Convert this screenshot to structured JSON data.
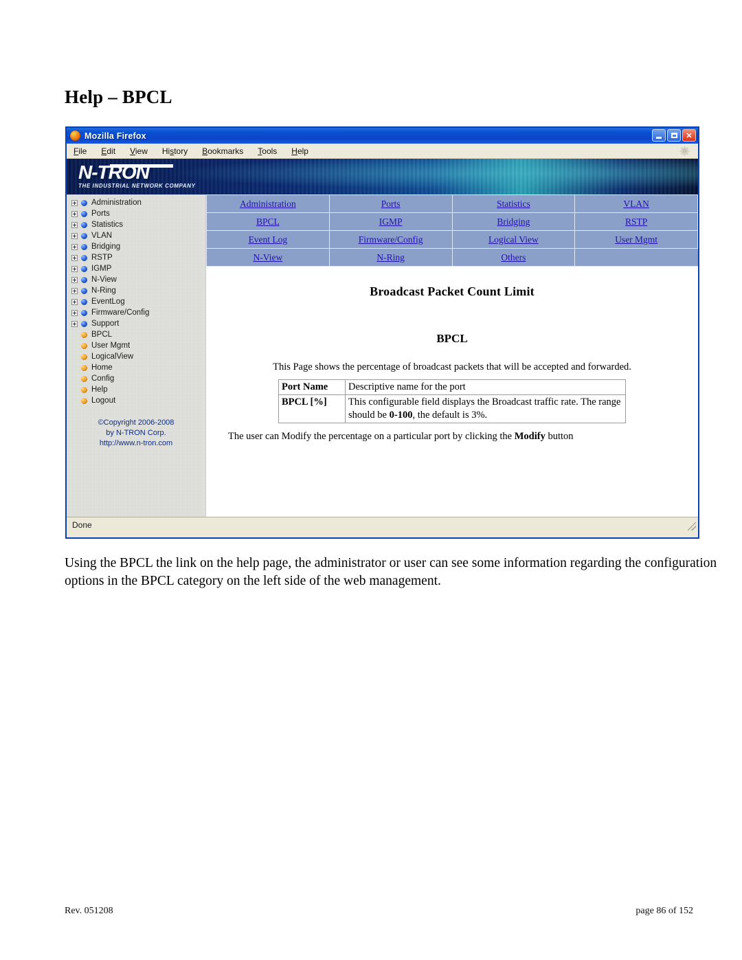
{
  "document": {
    "heading": "Help – BPCL",
    "paragraph": "Using the BPCL the link on the help page, the administrator or user can see some information regarding the configuration options in the BPCL category on the left side of the web management.",
    "footer_left": "Rev.  051208",
    "footer_right": "page 86 of 152"
  },
  "browser": {
    "title": "Mozilla Firefox",
    "app_icon": "firefox-icon",
    "window_buttons": {
      "minimize": "minimize-icon",
      "maximize": "maximize-icon",
      "close": "✕"
    },
    "menu": [
      {
        "label": "File",
        "accel": "F"
      },
      {
        "label": "Edit",
        "accel": "E"
      },
      {
        "label": "View",
        "accel": "V"
      },
      {
        "label": "History",
        "accel": "s"
      },
      {
        "label": "Bookmarks",
        "accel": "B"
      },
      {
        "label": "Tools",
        "accel": "T"
      },
      {
        "label": "Help",
        "accel": "H"
      }
    ],
    "toolbar_icon": "gear-icon",
    "status": "Done"
  },
  "banner": {
    "logo_text": "N-TRON",
    "logo_tagline": "THE INDUSTRIAL NETWORK COMPANY"
  },
  "sidebar": {
    "items": [
      {
        "label": "Administration",
        "expandable": true,
        "bullet": "blue"
      },
      {
        "label": "Ports",
        "expandable": true,
        "bullet": "blue"
      },
      {
        "label": "Statistics",
        "expandable": true,
        "bullet": "blue"
      },
      {
        "label": "VLAN",
        "expandable": true,
        "bullet": "blue"
      },
      {
        "label": "Bridging",
        "expandable": true,
        "bullet": "blue"
      },
      {
        "label": "RSTP",
        "expandable": true,
        "bullet": "blue"
      },
      {
        "label": "IGMP",
        "expandable": true,
        "bullet": "blue"
      },
      {
        "label": "N-View",
        "expandable": true,
        "bullet": "blue"
      },
      {
        "label": "N-Ring",
        "expandable": true,
        "bullet": "blue"
      },
      {
        "label": "EventLog",
        "expandable": true,
        "bullet": "blue"
      },
      {
        "label": "Firmware/Config",
        "expandable": true,
        "bullet": "blue"
      },
      {
        "label": "Support",
        "expandable": true,
        "bullet": "blue"
      },
      {
        "label": "BPCL",
        "expandable": false,
        "bullet": "orange"
      },
      {
        "label": "User Mgmt",
        "expandable": false,
        "bullet": "orange"
      },
      {
        "label": "LogicalView",
        "expandable": false,
        "bullet": "orange"
      },
      {
        "label": "Home",
        "expandable": false,
        "bullet": "orange"
      },
      {
        "label": "Config",
        "expandable": false,
        "bullet": "orange"
      },
      {
        "label": "Help",
        "expandable": false,
        "bullet": "orange"
      },
      {
        "label": "Logout",
        "expandable": false,
        "bullet": "orange"
      }
    ],
    "copyright": {
      "line1": "©Copyright 2006-2008",
      "line2": "by N-TRON Corp.",
      "line3": "http://www.n-tron.com"
    }
  },
  "link_grid": {
    "rows": [
      [
        "Administration",
        "Ports",
        "Statistics",
        "VLAN"
      ],
      [
        "BPCL",
        "IGMP",
        "Bridging",
        "RSTP"
      ],
      [
        "Event Log",
        "Firmware/Config",
        "Logical View",
        "User Mgmt"
      ],
      [
        "N-View",
        "N-Ring",
        "Others",
        ""
      ]
    ]
  },
  "help_page": {
    "title": "Broadcast Packet Count Limit",
    "subtitle": "BPCL",
    "description": "This Page shows the percentage of broadcast packets that will be accepted and forwarded.",
    "definitions": [
      {
        "term": "Port Name",
        "description_plain": "Descriptive name for the port"
      },
      {
        "term": "BPCL [%]",
        "description_pre": "This configurable field displays the Broadcast traffic rate. The range should be ",
        "description_strong": "0-100",
        "description_post": ", the default is 3%."
      }
    ],
    "footnote_pre": "The user can Modify the percentage on a particular port by clicking the ",
    "footnote_strong": "Modify",
    "footnote_post": " button"
  },
  "colors": {
    "titlebar_blue": "#0a4fd0",
    "link_blue": "#2212a8",
    "link_grid_bg": "#8aa0c8",
    "sidebar_bg": "#e8e8e4",
    "chrome_beige": "#ece9d8",
    "copyright_blue": "#0c2e86"
  }
}
